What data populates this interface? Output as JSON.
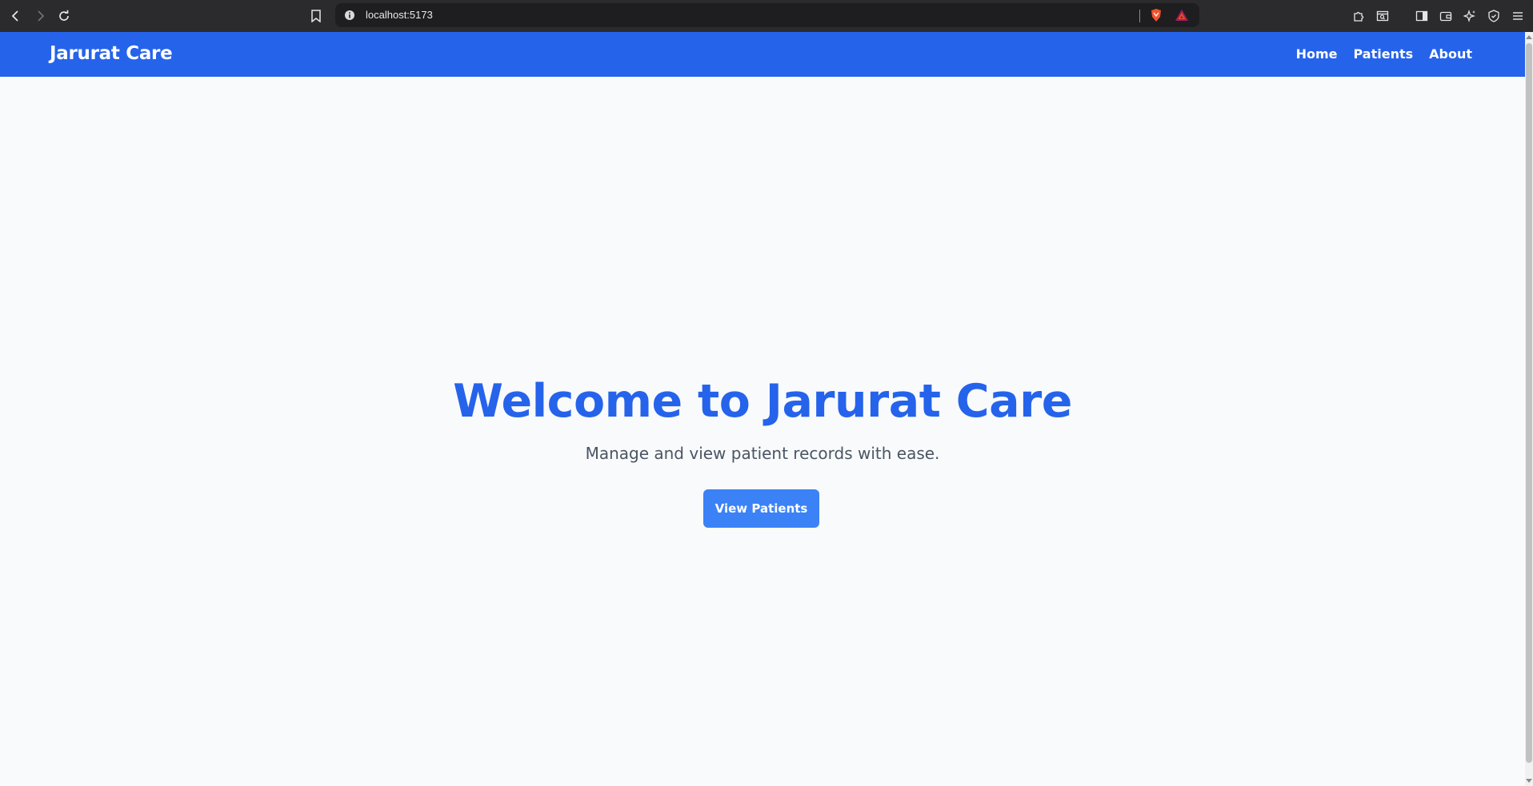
{
  "browser": {
    "url": "localhost:5173",
    "icons": {
      "back": "back-arrow-icon",
      "forward": "forward-arrow-icon",
      "reload": "reload-icon",
      "bookmark": "bookmark-icon",
      "site_info": "info-icon",
      "brave_shields": "brave-shields-icon",
      "brave_rewards": "brave-rewards-icon",
      "extensions": "puzzle-icon",
      "tab_search": "tab-search-icon",
      "sidebar": "sidebar-icon",
      "wallet": "wallet-icon",
      "leo": "sparkle-icon",
      "vpn": "shield-icon",
      "menu": "hamburger-menu-icon"
    }
  },
  "navbar": {
    "brand": "Jarurat Care",
    "links": [
      "Home",
      "Patients",
      "About"
    ],
    "background": "#2563eb"
  },
  "hero": {
    "title": "Welcome to Jarurat Care",
    "subtitle": "Manage and view patient records with ease.",
    "cta_label": "View Patients",
    "title_color": "#2563eb",
    "button_color": "#3b82f6"
  }
}
